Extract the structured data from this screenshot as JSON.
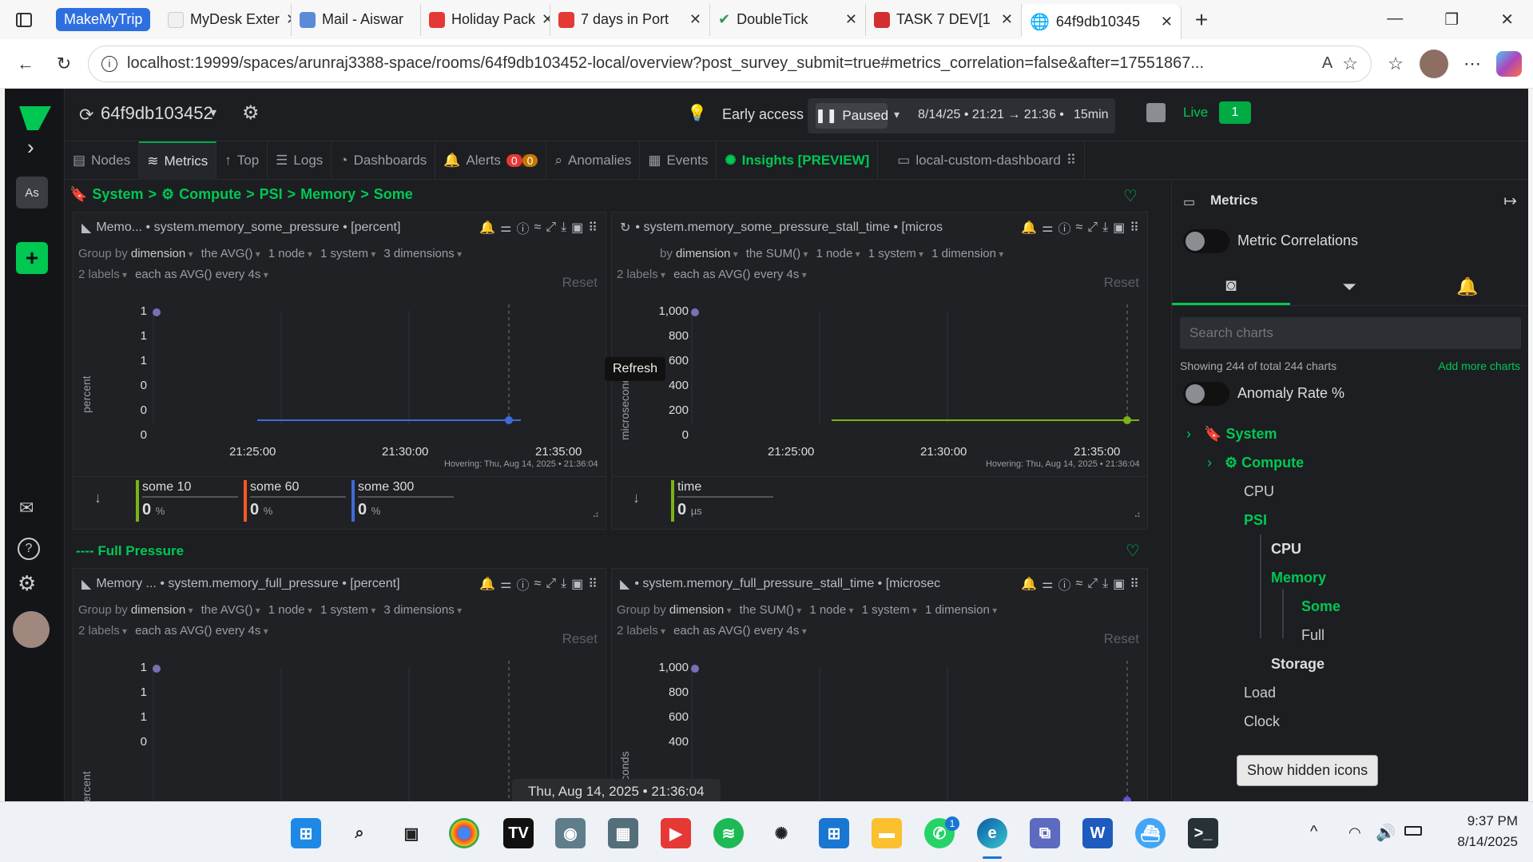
{
  "browser": {
    "tabs": [
      {
        "label": "MakeMyTrip",
        "kind": "badge"
      },
      {
        "label": "MyDesk Exter",
        "kind": "tab"
      },
      {
        "label": "Mail - Aiswar",
        "kind": "tab"
      },
      {
        "label": "Holiday Pack",
        "kind": "tab"
      },
      {
        "label": "7 days in Port",
        "kind": "tab"
      },
      {
        "label": "DoubleTick",
        "kind": "tab"
      },
      {
        "label": "TASK 7 DEV[1",
        "kind": "tab"
      },
      {
        "label": "64f9db10345",
        "kind": "active"
      }
    ],
    "url": "localhost:19999/spaces/arunraj3388-space/rooms/64f9db103452-local/overview?post_survey_submit=true#metrics_correlation=false&after=17551867..."
  },
  "topbar": {
    "room": "64f9db103452",
    "early_access": "Early access",
    "paused": "Paused",
    "date_range": "8/14/25 • 21:21 → 21:36 •",
    "duration": "15min",
    "live": "Live",
    "live_count": "1",
    "avatar_initials": "As"
  },
  "tabs": {
    "nodes": "Nodes",
    "metrics": "Metrics",
    "top": "Top",
    "logs": "Logs",
    "dashboards": "Dashboards",
    "alerts": "Alerts",
    "alerts_a": "0",
    "alerts_b": "0",
    "anomalies": "Anomalies",
    "events": "Events",
    "insights": "Insights [PREVIEW]",
    "custom": "local-custom-dashboard"
  },
  "breadcrumb": {
    "system": "System",
    "compute": "Compute",
    "psi": "PSI",
    "memory": "Memory",
    "some": "Some"
  },
  "section_full": "---- Full Pressure",
  "tooltip_refresh": "Refresh",
  "charts": {
    "c1": {
      "title": "Memo... • system.memory_some_pressure • [percent]",
      "group_by": "Group by",
      "dimension": "dimension",
      "agg": "the AVG()",
      "nodes": "1 node",
      "systems": "1 system",
      "dims": "3 dimensions",
      "labels": "2 labels",
      "each": "each as AVG() every 4s",
      "reset": "Reset",
      "ylabel": "percent",
      "yticks": [
        "1",
        "1",
        "1",
        "0",
        "0",
        "0"
      ],
      "xticks": [
        "21:25:00",
        "21:30:00",
        "21:35:00"
      ],
      "hovering": "Hovering: Thu, Aug 14, 2025 • 21:36:04",
      "legend": [
        {
          "name": "some 10",
          "value": "0",
          "unit": "%",
          "color": "#7ab317"
        },
        {
          "name": "some 60",
          "value": "0",
          "unit": "%",
          "color": "#ff5722"
        },
        {
          "name": "some 300",
          "value": "0",
          "unit": "%",
          "color": "#3f6ad8"
        }
      ]
    },
    "c2": {
      "title": "• system.memory_some_pressure_stall_time • [micros",
      "group_by": "by",
      "dimension": "dimension",
      "agg": "the SUM()",
      "nodes": "1 node",
      "systems": "1 system",
      "dims": "1 dimension",
      "labels": "2 labels",
      "each": "each as AVG() every 4s",
      "reset": "Reset",
      "ylabel": "microseconds",
      "yticks": [
        "1,000",
        "800",
        "600",
        "400",
        "200",
        "0"
      ],
      "xticks": [
        "21:25:00",
        "21:30:00",
        "21:35:00"
      ],
      "hovering": "Hovering: Thu, Aug 14, 2025 • 21:36:04",
      "legend": [
        {
          "name": "time",
          "value": "0",
          "unit": "µs",
          "color": "#7ab317"
        }
      ]
    },
    "c3": {
      "title": "Memory ... • system.memory_full_pressure • [percent]",
      "group_by": "Group by",
      "dimension": "dimension",
      "agg": "the AVG()",
      "nodes": "1 node",
      "systems": "1 system",
      "dims": "3 dimensions",
      "labels": "2 labels",
      "each": "each as AVG() every 4s",
      "reset": "Reset",
      "ylabel": "percent",
      "yticks": [
        "1",
        "1",
        "1",
        "0"
      ]
    },
    "c4": {
      "title": "• system.memory_full_pressure_stall_time • [microsec",
      "group_by": "Group by",
      "dimension": "dimension",
      "agg": "the SUM()",
      "nodes": "1 node",
      "systems": "1 system",
      "dims": "1 dimension",
      "labels": "2 labels",
      "each": "each as AVG() every 4s",
      "reset": "Reset",
      "ylabel": "croseconds",
      "yticks": [
        "1,000",
        "800",
        "600",
        "400"
      ]
    }
  },
  "timestamp_pill": "Thu, Aug 14, 2025 • 21:36:04",
  "right": {
    "title": "Metrics",
    "metric_correlations": "Metric Correlations",
    "search_placeholder": "Search charts",
    "showing": "Showing 244 of total 244 charts",
    "add_more": "Add more charts",
    "anomaly": "Anomaly Rate %",
    "tree": {
      "system": "System",
      "compute": "Compute",
      "cpu": "CPU",
      "psi": "PSI",
      "psi_cpu": "CPU",
      "memory": "Memory",
      "some": "Some",
      "full": "Full",
      "storage": "Storage",
      "load": "Load",
      "clock": "Clock"
    }
  },
  "show_hidden": "Show hidden icons",
  "taskbar": {
    "time": "9:37 PM",
    "date": "8/14/2025",
    "whatsapp_badge": "1"
  }
}
